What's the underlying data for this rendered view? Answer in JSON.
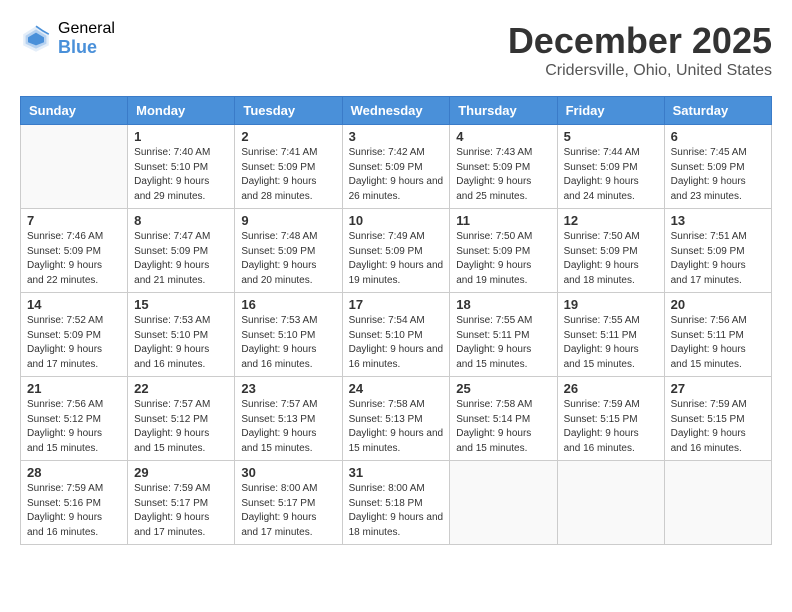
{
  "logo": {
    "general": "General",
    "blue": "Blue"
  },
  "header": {
    "month": "December 2025",
    "location": "Cridersville, Ohio, United States"
  },
  "weekdays": [
    "Sunday",
    "Monday",
    "Tuesday",
    "Wednesday",
    "Thursday",
    "Friday",
    "Saturday"
  ],
  "weeks": [
    [
      {
        "day": "",
        "empty": true
      },
      {
        "day": "1",
        "sunrise": "7:40 AM",
        "sunset": "5:10 PM",
        "daylight": "9 hours and 29 minutes."
      },
      {
        "day": "2",
        "sunrise": "7:41 AM",
        "sunset": "5:09 PM",
        "daylight": "9 hours and 28 minutes."
      },
      {
        "day": "3",
        "sunrise": "7:42 AM",
        "sunset": "5:09 PM",
        "daylight": "9 hours and 26 minutes."
      },
      {
        "day": "4",
        "sunrise": "7:43 AM",
        "sunset": "5:09 PM",
        "daylight": "9 hours and 25 minutes."
      },
      {
        "day": "5",
        "sunrise": "7:44 AM",
        "sunset": "5:09 PM",
        "daylight": "9 hours and 24 minutes."
      },
      {
        "day": "6",
        "sunrise": "7:45 AM",
        "sunset": "5:09 PM",
        "daylight": "9 hours and 23 minutes."
      }
    ],
    [
      {
        "day": "7",
        "sunrise": "7:46 AM",
        "sunset": "5:09 PM",
        "daylight": "9 hours and 22 minutes."
      },
      {
        "day": "8",
        "sunrise": "7:47 AM",
        "sunset": "5:09 PM",
        "daylight": "9 hours and 21 minutes."
      },
      {
        "day": "9",
        "sunrise": "7:48 AM",
        "sunset": "5:09 PM",
        "daylight": "9 hours and 20 minutes."
      },
      {
        "day": "10",
        "sunrise": "7:49 AM",
        "sunset": "5:09 PM",
        "daylight": "9 hours and 19 minutes."
      },
      {
        "day": "11",
        "sunrise": "7:50 AM",
        "sunset": "5:09 PM",
        "daylight": "9 hours and 19 minutes."
      },
      {
        "day": "12",
        "sunrise": "7:50 AM",
        "sunset": "5:09 PM",
        "daylight": "9 hours and 18 minutes."
      },
      {
        "day": "13",
        "sunrise": "7:51 AM",
        "sunset": "5:09 PM",
        "daylight": "9 hours and 17 minutes."
      }
    ],
    [
      {
        "day": "14",
        "sunrise": "7:52 AM",
        "sunset": "5:09 PM",
        "daylight": "9 hours and 17 minutes."
      },
      {
        "day": "15",
        "sunrise": "7:53 AM",
        "sunset": "5:10 PM",
        "daylight": "9 hours and 16 minutes."
      },
      {
        "day": "16",
        "sunrise": "7:53 AM",
        "sunset": "5:10 PM",
        "daylight": "9 hours and 16 minutes."
      },
      {
        "day": "17",
        "sunrise": "7:54 AM",
        "sunset": "5:10 PM",
        "daylight": "9 hours and 16 minutes."
      },
      {
        "day": "18",
        "sunrise": "7:55 AM",
        "sunset": "5:11 PM",
        "daylight": "9 hours and 15 minutes."
      },
      {
        "day": "19",
        "sunrise": "7:55 AM",
        "sunset": "5:11 PM",
        "daylight": "9 hours and 15 minutes."
      },
      {
        "day": "20",
        "sunrise": "7:56 AM",
        "sunset": "5:11 PM",
        "daylight": "9 hours and 15 minutes."
      }
    ],
    [
      {
        "day": "21",
        "sunrise": "7:56 AM",
        "sunset": "5:12 PM",
        "daylight": "9 hours and 15 minutes."
      },
      {
        "day": "22",
        "sunrise": "7:57 AM",
        "sunset": "5:12 PM",
        "daylight": "9 hours and 15 minutes."
      },
      {
        "day": "23",
        "sunrise": "7:57 AM",
        "sunset": "5:13 PM",
        "daylight": "9 hours and 15 minutes."
      },
      {
        "day": "24",
        "sunrise": "7:58 AM",
        "sunset": "5:13 PM",
        "daylight": "9 hours and 15 minutes."
      },
      {
        "day": "25",
        "sunrise": "7:58 AM",
        "sunset": "5:14 PM",
        "daylight": "9 hours and 15 minutes."
      },
      {
        "day": "26",
        "sunrise": "7:59 AM",
        "sunset": "5:15 PM",
        "daylight": "9 hours and 16 minutes."
      },
      {
        "day": "27",
        "sunrise": "7:59 AM",
        "sunset": "5:15 PM",
        "daylight": "9 hours and 16 minutes."
      }
    ],
    [
      {
        "day": "28",
        "sunrise": "7:59 AM",
        "sunset": "5:16 PM",
        "daylight": "9 hours and 16 minutes."
      },
      {
        "day": "29",
        "sunrise": "7:59 AM",
        "sunset": "5:17 PM",
        "daylight": "9 hours and 17 minutes."
      },
      {
        "day": "30",
        "sunrise": "8:00 AM",
        "sunset": "5:17 PM",
        "daylight": "9 hours and 17 minutes."
      },
      {
        "day": "31",
        "sunrise": "8:00 AM",
        "sunset": "5:18 PM",
        "daylight": "9 hours and 18 minutes."
      },
      {
        "day": "",
        "empty": true
      },
      {
        "day": "",
        "empty": true
      },
      {
        "day": "",
        "empty": true
      }
    ]
  ]
}
